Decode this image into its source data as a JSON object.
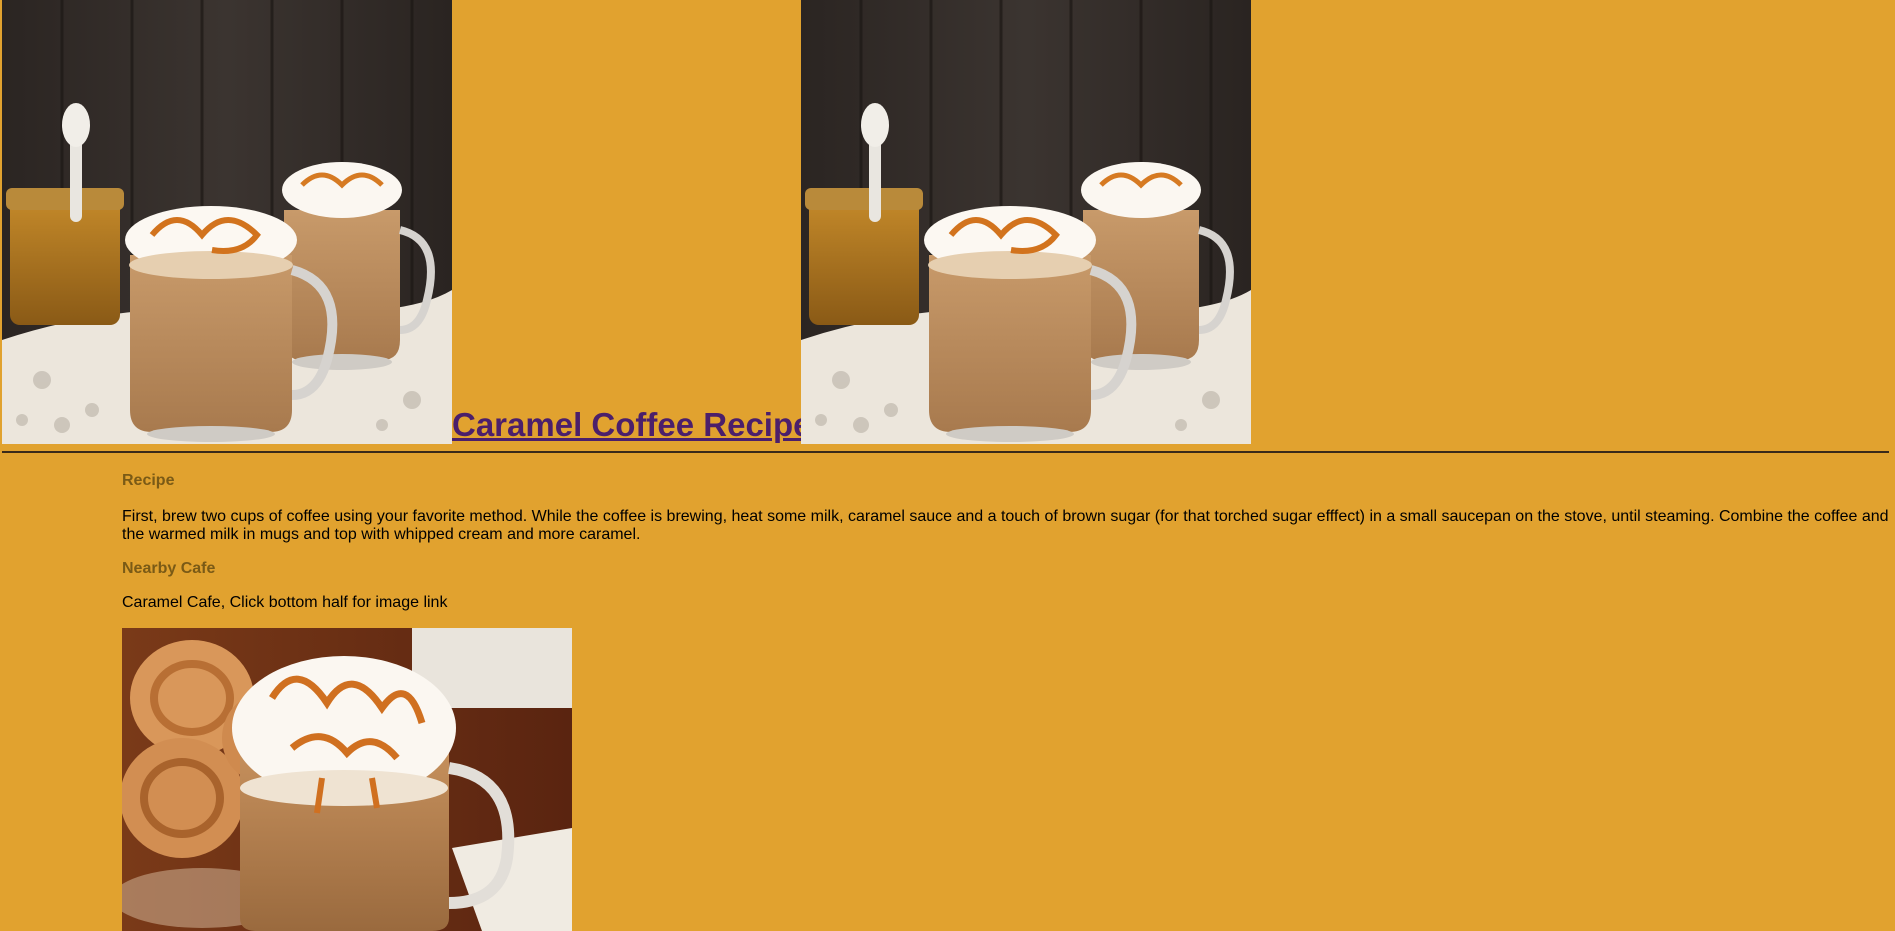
{
  "page": {
    "background": "#e1a22f",
    "title_link_color": "#4b1f6b",
    "heading_color": "#7a5a16"
  },
  "header": {
    "title": "Caramel Coffee Recipe",
    "images": [
      {
        "name": "caramel-coffee-mugs-photo"
      },
      {
        "name": "caramel-coffee-mugs-photo"
      }
    ]
  },
  "recipe": {
    "heading": "Recipe",
    "text": "First, brew two cups of coffee using your favorite method. While the coffee is brewing, heat some milk, caramel sauce and a touch of brown sugar (for that torched sugar efffect) in a small saucepan on the stove, until steaming. Combine the coffee and the warmed milk in mugs and top with whipped cream and more caramel."
  },
  "cafe": {
    "heading": "Nearby Cafe",
    "text": "Caramel Cafe, Click bottom half for image link",
    "image": {
      "name": "caramel-latte-cookies-photo"
    }
  }
}
